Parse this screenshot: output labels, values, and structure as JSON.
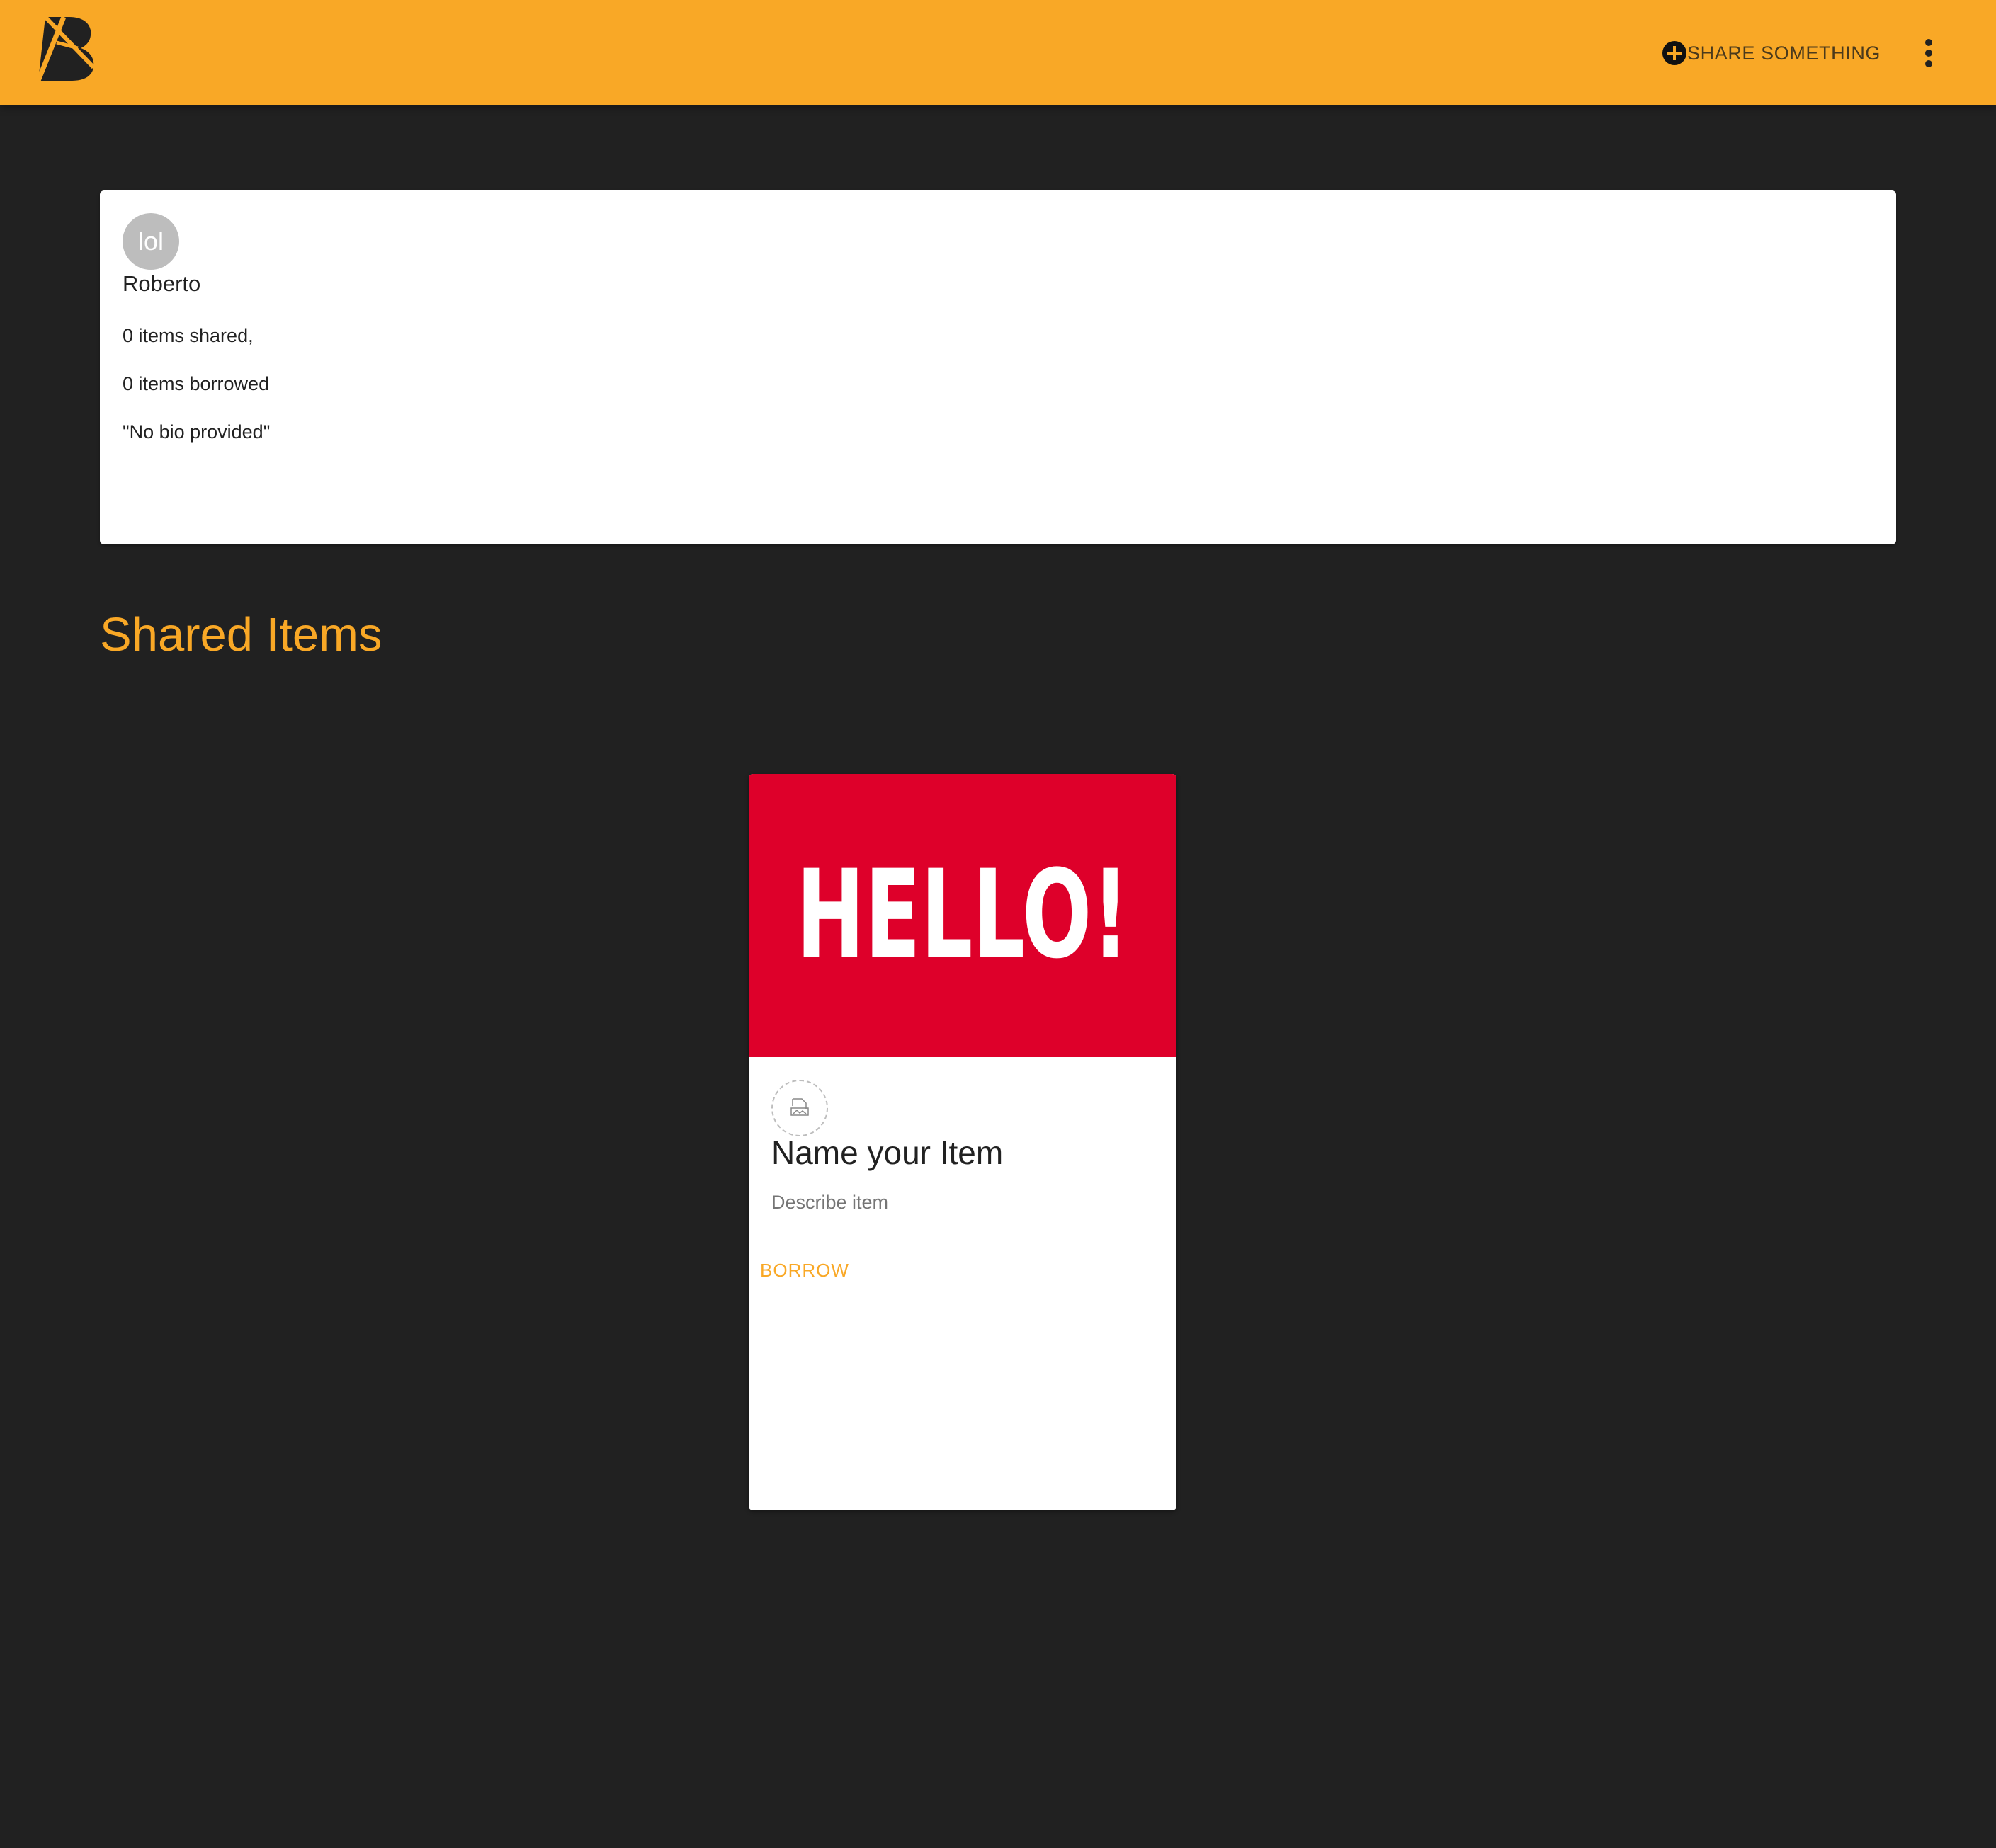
{
  "app": {
    "logo_icon": "boomtown-b-logo-icon",
    "brand_color": "#f9a826",
    "background_color": "#212121"
  },
  "toolbar": {
    "share_icon": "plus-circle-icon",
    "share_label": "SHARE SOMETHING",
    "more_icon": "more-vertical-icon"
  },
  "profile": {
    "avatar_text": "lol",
    "name": "Roberto",
    "items_shared": "0 items shared,",
    "items_borrowed": "0 items borrowed",
    "bio": "\"No bio provided\""
  },
  "shared_section": {
    "title": "Shared Items",
    "items": [
      {
        "image_text": "HELLO!",
        "image_color": "#de002a",
        "owner_avatar_icon": "broken-image-icon",
        "title": "Name your Item",
        "description": "Describe item",
        "action_label": "BORROW"
      }
    ]
  }
}
